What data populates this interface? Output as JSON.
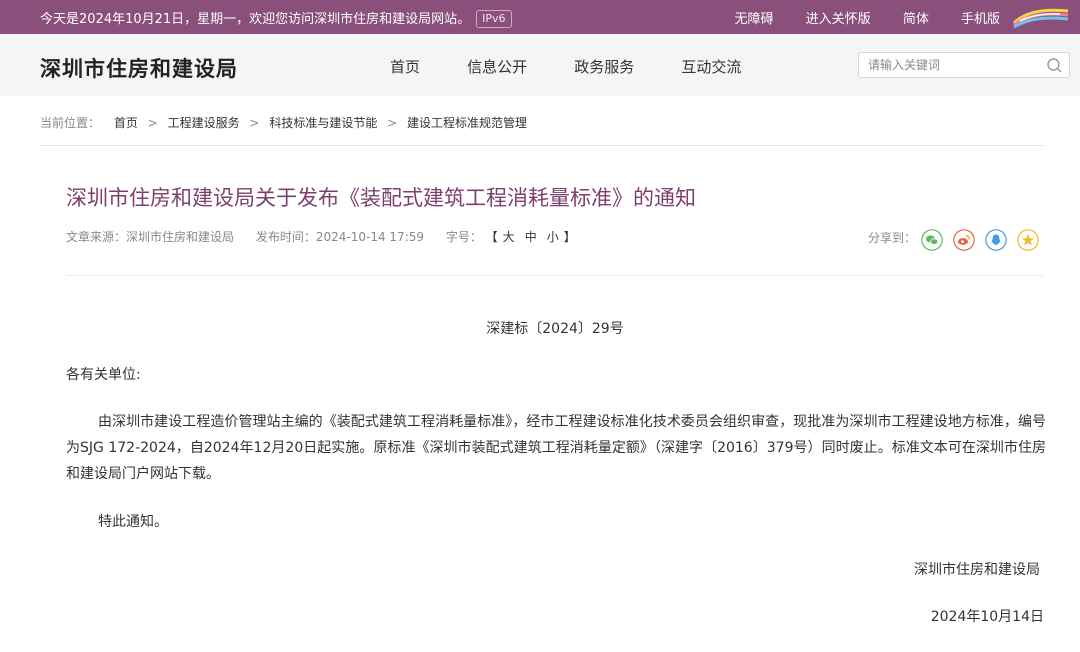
{
  "topbar": {
    "welcome": "今天是2024年10月21日，星期一，欢迎您访问深圳市住房和建设局网站。",
    "ipv6": "IPv6",
    "links": [
      "无障碍",
      "进入关怀版",
      "简体",
      "手机版"
    ],
    "bg_color": "#8a4f7a"
  },
  "header": {
    "site_title": "深圳市住房和建设局",
    "nav": [
      "首页",
      "信息公开",
      "政务服务",
      "互动交流"
    ],
    "search": {
      "placeholder": "请输入关键词",
      "icon": "search-icon"
    }
  },
  "breadcrumb": {
    "label": "当前位置：",
    "items": [
      "首页",
      "工程建设服务",
      "科技标准与建设节能",
      "建设工程标准规范管理"
    ],
    "separator": ">"
  },
  "article": {
    "title": "深圳市住房和建设局关于发布《装配式建筑工程消耗量标准》的通知",
    "title_color": "#7d3f6e",
    "source": "文章来源：深圳市住房和建设局",
    "publish_time": "发布时间：2024-10-14 17:59",
    "font_size_label": "字号：",
    "font_size_options": [
      "大",
      "中",
      "小"
    ],
    "share_label": "分享到：",
    "share_icons": [
      "wechat-icon",
      "weibo-icon",
      "qq-icon",
      "qzone-icon"
    ],
    "doc_number": "深建标〔2024〕29号",
    "recipient": "各有关单位:",
    "body": "由深圳市建设工程造价管理站主编的《装配式建筑工程消耗量标准》，经市工程建设标准化技术委员会组织审查，现批准为深圳市工程建设地方标准，编号为SJG 172-2024，自2024年12月20日起实施。原标准《深圳市装配式建筑工程消耗量定额》（深建字〔2016〕379号）同时废止。标准文本可在深圳市住房和建设局门户网站下载。",
    "closing": "特此通知。",
    "signer": "深圳市住房和建设局",
    "date": "2024年10月14日"
  }
}
